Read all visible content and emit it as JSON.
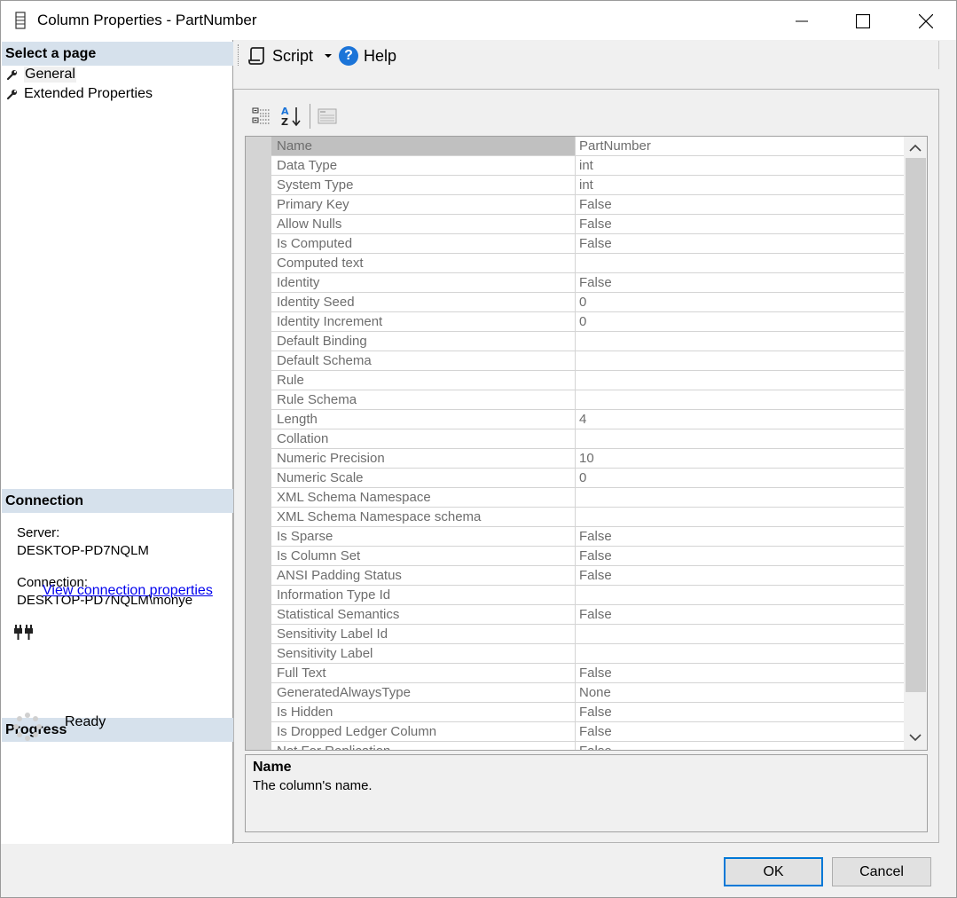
{
  "window": {
    "title": "Column Properties - PartNumber"
  },
  "left": {
    "select_page_header": "Select a page",
    "pages": [
      {
        "label": "General",
        "selected": true
      },
      {
        "label": "Extended Properties",
        "selected": false
      }
    ],
    "connection_header": "Connection",
    "server_label": "Server:",
    "server_value": "DESKTOP-PD7NQLM",
    "connection_label": "Connection:",
    "connection_value": "DESKTOP-PD7NQLM\\monye",
    "view_connection_link": "View connection properties",
    "progress_header": "Progress",
    "progress_status": "Ready"
  },
  "toolbar": {
    "script_label": "Script",
    "help_label": "Help"
  },
  "properties": [
    {
      "name": "Name",
      "value": "PartNumber"
    },
    {
      "name": "Data Type",
      "value": "int"
    },
    {
      "name": "System Type",
      "value": "int"
    },
    {
      "name": "Primary Key",
      "value": "False"
    },
    {
      "name": "Allow Nulls",
      "value": "False"
    },
    {
      "name": "Is Computed",
      "value": "False"
    },
    {
      "name": "Computed text",
      "value": ""
    },
    {
      "name": "Identity",
      "value": "False"
    },
    {
      "name": "Identity Seed",
      "value": "0"
    },
    {
      "name": "Identity Increment",
      "value": "0"
    },
    {
      "name": "Default Binding",
      "value": ""
    },
    {
      "name": "Default Schema",
      "value": ""
    },
    {
      "name": "Rule",
      "value": ""
    },
    {
      "name": "Rule Schema",
      "value": ""
    },
    {
      "name": "Length",
      "value": "4"
    },
    {
      "name": "Collation",
      "value": ""
    },
    {
      "name": "Numeric Precision",
      "value": "10"
    },
    {
      "name": "Numeric Scale",
      "value": "0"
    },
    {
      "name": "XML Schema Namespace",
      "value": ""
    },
    {
      "name": "XML Schema Namespace schema",
      "value": ""
    },
    {
      "name": "Is Sparse",
      "value": "False"
    },
    {
      "name": "Is Column Set",
      "value": "False"
    },
    {
      "name": "ANSI Padding Status",
      "value": "False"
    },
    {
      "name": "Information Type Id",
      "value": ""
    },
    {
      "name": "Statistical Semantics",
      "value": "False"
    },
    {
      "name": "Sensitivity Label Id",
      "value": ""
    },
    {
      "name": "Sensitivity Label",
      "value": ""
    },
    {
      "name": "Full Text",
      "value": "False"
    },
    {
      "name": "GeneratedAlwaysType",
      "value": "None"
    },
    {
      "name": "Is Hidden",
      "value": "False"
    },
    {
      "name": "Is Dropped Ledger Column",
      "value": "False"
    },
    {
      "name": "Not For Replication",
      "value": "False"
    }
  ],
  "description": {
    "title": "Name",
    "text": "The column's name."
  },
  "buttons": {
    "ok": "OK",
    "cancel": "Cancel"
  }
}
